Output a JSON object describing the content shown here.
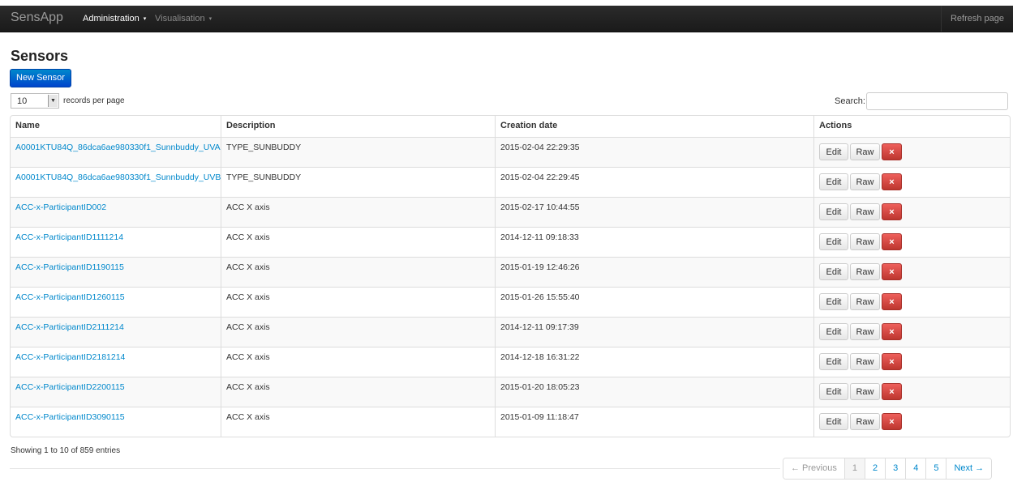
{
  "navbar": {
    "brand": "SensApp",
    "menu": [
      {
        "label": "Administration",
        "caret": "▾",
        "active": true
      },
      {
        "label": "Visualisation",
        "caret": "▾",
        "active": false
      }
    ],
    "refresh_label": "Refresh page"
  },
  "page": {
    "title": "Sensors",
    "new_button": "New Sensor"
  },
  "controls": {
    "page_length": "10",
    "records_label": "records per page",
    "search_label": "Search:",
    "search_value": ""
  },
  "table": {
    "columns": [
      "Name",
      "Description",
      "Creation date",
      "Actions"
    ],
    "rows": [
      {
        "name": "A0001KTU84Q_86dca6ae980330f1_Sunnbuddy_UVA",
        "description": "TYPE_SUNBUDDY",
        "date": "2015-02-04 22:29:35"
      },
      {
        "name": "A0001KTU84Q_86dca6ae980330f1_Sunnbuddy_UVB",
        "description": "TYPE_SUNBUDDY",
        "date": "2015-02-04 22:29:45"
      },
      {
        "name": "ACC-x-ParticipantID002",
        "description": "ACC X axis",
        "date": "2015-02-17 10:44:55"
      },
      {
        "name": "ACC-x-ParticipantID1111214",
        "description": "ACC X axis",
        "date": "2014-12-11 09:18:33"
      },
      {
        "name": "ACC-x-ParticipantID1190115",
        "description": "ACC X axis",
        "date": "2015-01-19 12:46:26"
      },
      {
        "name": "ACC-x-ParticipantID1260115",
        "description": "ACC X axis",
        "date": "2015-01-26 15:55:40"
      },
      {
        "name": "ACC-x-ParticipantID2111214",
        "description": "ACC X axis",
        "date": "2014-12-11 09:17:39"
      },
      {
        "name": "ACC-x-ParticipantID2181214",
        "description": "ACC X axis",
        "date": "2014-12-18 16:31:22"
      },
      {
        "name": "ACC-x-ParticipantID2200115",
        "description": "ACC X axis",
        "date": "2015-01-20 18:05:23"
      },
      {
        "name": "ACC-x-ParticipantID3090115",
        "description": "ACC X axis",
        "date": "2015-01-09 11:18:47"
      }
    ],
    "actions": {
      "edit": "Edit",
      "raw": "Raw",
      "delete": "×"
    }
  },
  "footer": {
    "info": "Showing 1 to 10 of 859 entries",
    "pagination": [
      {
        "label": "← Previous",
        "state": "disabled"
      },
      {
        "label": "1",
        "state": "active"
      },
      {
        "label": "2",
        "state": ""
      },
      {
        "label": "3",
        "state": ""
      },
      {
        "label": "4",
        "state": ""
      },
      {
        "label": "5",
        "state": ""
      },
      {
        "label": "Next →",
        "state": ""
      }
    ]
  }
}
